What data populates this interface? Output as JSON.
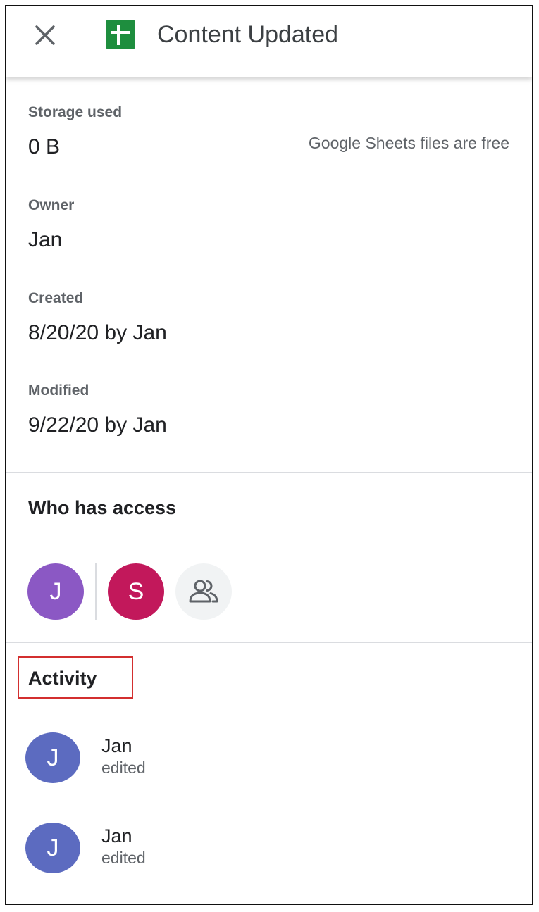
{
  "header": {
    "title": "Content Updated",
    "close_icon": "close-icon",
    "app_icon": "google-sheets-icon"
  },
  "details": {
    "storage": {
      "label": "Storage used",
      "value": "0 B",
      "note": "Google Sheets files are free"
    },
    "owner": {
      "label": "Owner",
      "value": "Jan"
    },
    "created": {
      "label": "Created",
      "value": "8/20/20 by Jan"
    },
    "modified": {
      "label": "Modified",
      "value": "9/22/20 by Jan"
    }
  },
  "access": {
    "title": "Who has access",
    "owner_avatar": {
      "initial": "J",
      "color": "#8b58c4"
    },
    "shared_avatars": [
      {
        "initial": "S",
        "color": "#c2185b"
      }
    ],
    "manage_icon": "people-icon"
  },
  "activity": {
    "title": "Activity",
    "items": [
      {
        "initial": "J",
        "name": "Jan",
        "action": "edited",
        "color": "#5c6bc0"
      },
      {
        "initial": "J",
        "name": "Jan",
        "action": "edited",
        "color": "#5c6bc0"
      }
    ]
  },
  "colors": {
    "sheets_green": "#1e8e3e",
    "highlight_red": "#d32f2f",
    "divider": "#dadce0"
  }
}
